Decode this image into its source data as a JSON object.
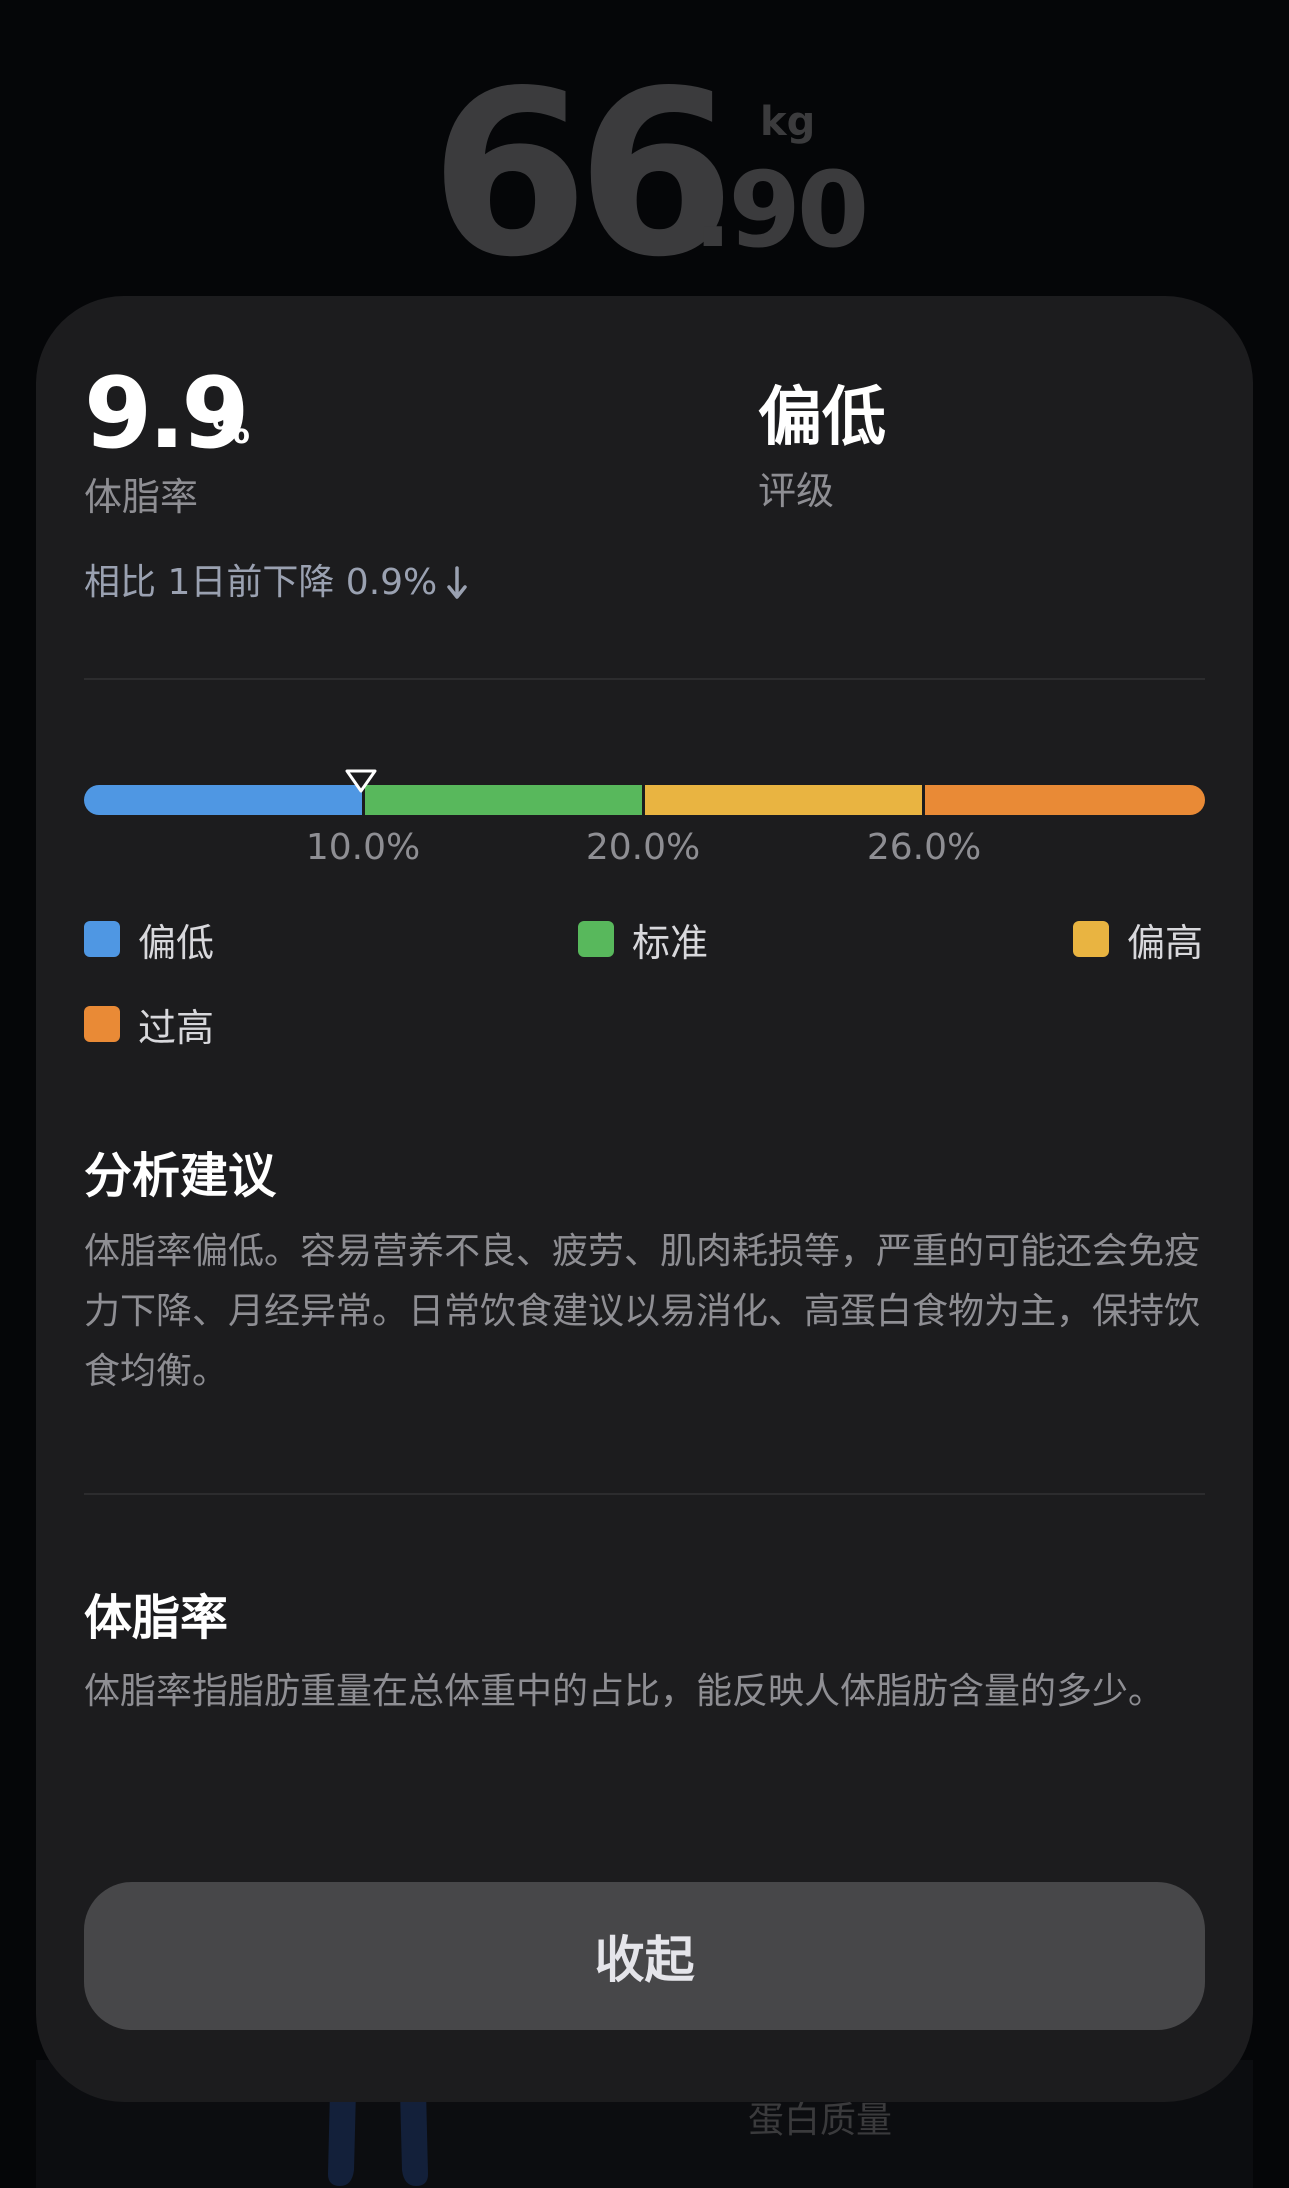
{
  "background": {
    "weight_int": "66",
    "weight_dec": ".90",
    "weight_unit": "kg",
    "bottom_label": "蛋白质量"
  },
  "detail": {
    "metric_value": "9.9",
    "metric_unit": "%",
    "metric_label": "体脂率",
    "grade_value": "偏低",
    "grade_label": "评级",
    "compare_text": "相比 1日前下降 0.9%",
    "compare_icon": "arrow-down-icon"
  },
  "range": {
    "current_value": 9.9,
    "thresholds": [
      "10.0%",
      "20.0%",
      "26.0%"
    ],
    "segments": [
      {
        "label": "偏低",
        "color": "#4f97e3"
      },
      {
        "label": "标准",
        "color": "#58b85c"
      },
      {
        "label": "偏高",
        "color": "#e9b441"
      },
      {
        "label": "过高",
        "color": "#e98a36"
      }
    ]
  },
  "analysis": {
    "title": "分析建议",
    "body": "体脂率偏低。容易营养不良、疲劳、肌肉耗损等，严重的可能还会免疫力下降、月经异常。日常饮食建议以易消化、高蛋白食物为主，保持饮食均衡。"
  },
  "definition": {
    "title": "体脂率",
    "body": "体脂率指脂肪重量在总体重中的占比，能反映人体脂肪含量的多少。"
  },
  "collapse_label": "收起"
}
